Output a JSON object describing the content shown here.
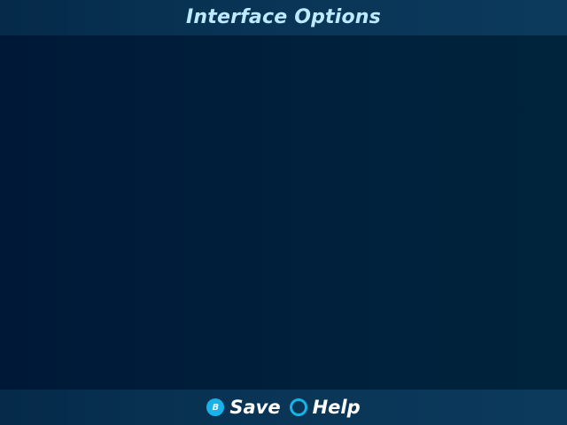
{
  "header": {
    "title": "Interface Options"
  },
  "footer": {
    "actions": [
      {
        "icon": "b-button-icon",
        "glyph": "B",
        "label": "Save"
      },
      {
        "icon": "circle-button-icon",
        "glyph": "",
        "label": "Help"
      }
    ]
  },
  "colors": {
    "accent": "#17b3e8",
    "title": "#bfe9ff",
    "bar": "#0a3556",
    "background": "#001d3a"
  }
}
